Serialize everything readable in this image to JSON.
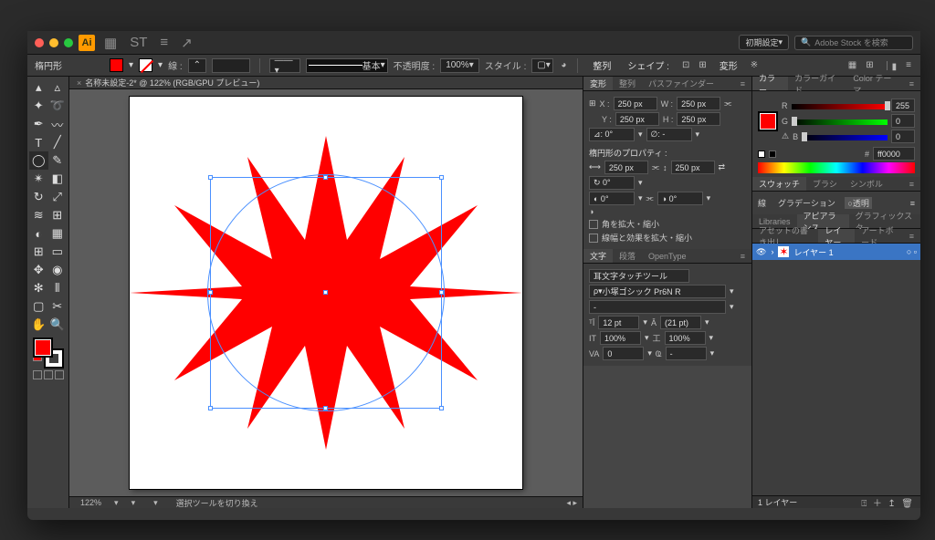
{
  "app": {
    "logo": "Ai",
    "workspace": "初期設定",
    "search_placeholder": "Adobe Stock を検索"
  },
  "titlebar_icons": [
    "▦",
    "ST",
    "≡",
    "↗"
  ],
  "control": {
    "toolname": "楕円形",
    "stroke_label": "線 :",
    "stroke_style_label": "基本",
    "opacity_label": "不透明度 :",
    "opacity": "100%",
    "style_label": "スタイル :",
    "align_label": "整列",
    "shape_label": "シェイプ :",
    "transform_label": "変形",
    "tail_icons": [
      "▦",
      "⊞",
      "｜▮",
      "≡"
    ]
  },
  "doc": {
    "tab": "名称未設定-2* @ 122% (RGB/GPU プレビュー)",
    "zoom": "122%",
    "status": "選択ツールを切り換え"
  },
  "transform": {
    "tabs": [
      "変形",
      "整列",
      "パスファインダー"
    ],
    "x_label": "X :",
    "x": "250 px",
    "w_label": "W :",
    "w": "250 px",
    "y_label": "Y :",
    "y": "250 px",
    "h_label": "H :",
    "h": "250 px",
    "angle": "⊿: 0°",
    "shear": "∅: -",
    "prop_header": "楕円形のプロパティ :",
    "pw": "250 px",
    "ph": "250 px",
    "rot": "↻ 0°",
    "pie1": "◐ 0°",
    "pie2": "◑ 0°",
    "opt1": "角を拡大・縮小",
    "opt2": "線幅と効果を拡大・縮小"
  },
  "type": {
    "tabs": [
      "文字",
      "段落",
      "OpenType"
    ],
    "touch": "文字タッチツール",
    "font": "小塚ゴシック Pr6N R",
    "style": "-",
    "size_lbl": "ᵀĪ",
    "size": "12 pt",
    "leading_lbl": "Â",
    "leading": "(21 pt)",
    "track_lbl": "IT",
    "track": "100%",
    "vscale_lbl": "工",
    "vscale": "100%",
    "kern_lbl": "VA",
    "kern": "0",
    "aki_lbl": "Ҩ",
    "aki": "-"
  },
  "color": {
    "tabs": [
      "カラー",
      "カラーガイド",
      "Color テーマ"
    ],
    "r_label": "R",
    "r": "255",
    "g_label": "G",
    "g": "0",
    "b_label": "B",
    "b": "0",
    "hex_label": "#",
    "hex": "ff0000"
  },
  "swatch": {
    "tabs": [
      "スウォッチ",
      "ブラシ",
      "シンボル"
    ],
    "modes": [
      "線",
      "グラデーション",
      "透明"
    ],
    "active_mode": 2
  },
  "appearance": {
    "tabs": [
      "Libraries",
      "アピアランス",
      "グラフィックスタ…"
    ],
    "tabs2": [
      "アセットの書き出し",
      "レイヤー",
      "アートボード"
    ],
    "layer": "レイヤー 1",
    "footer": "1 レイヤー",
    "icons": [
      "⍐",
      "＋",
      "↥",
      "🗑"
    ]
  }
}
